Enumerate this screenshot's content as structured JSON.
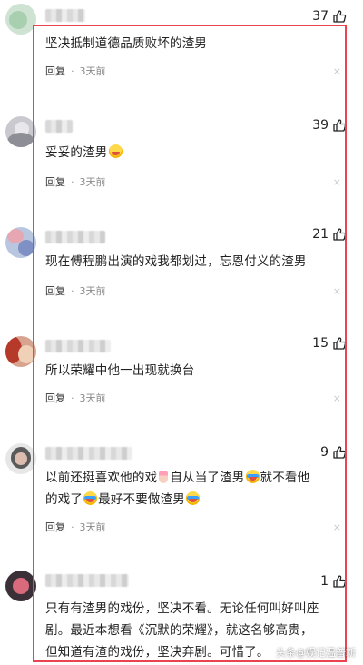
{
  "comments": [
    {
      "likes": "37",
      "text": "坚决抵制道德品质败坏的渣男",
      "reply": "回复",
      "time": "3天前",
      "close": "×"
    },
    {
      "likes": "39",
      "text": "妥妥的渣男",
      "reply": "回复",
      "time": "3天前",
      "close": "×"
    },
    {
      "likes": "21",
      "text": "现在傅程鹏出演的戏我都划过，忘恩付义的渣男",
      "reply": "回复",
      "time": "3天前",
      "close": "×"
    },
    {
      "likes": "15",
      "text": "所以荣耀中他一出现就换台",
      "reply": "回复",
      "time": "3天前",
      "close": "×"
    },
    {
      "likes": "9",
      "text_part1": "以前还挺喜欢他的戏",
      "text_part2": "自从当了渣男",
      "text_part3": "就不看他的戏了",
      "text_part4": "最好不要做渣男",
      "reply": "回复",
      "time": "3天前",
      "close": "×"
    },
    {
      "likes": "1",
      "text": "只有有渣男的戏份，坚决不看。无论任何叫好叫座剧。最近本想看《沉默的荣耀》，就这名够高贵，但知道有渣的戏份，坚决弃剧。可惜了。"
    }
  ],
  "dot": "·",
  "watermark": "头条@娱记温普新",
  "colors": {
    "frame": "#e9444f"
  },
  "icons": {
    "like": "thumbs-up-icon",
    "close": "close-icon",
    "emoji_laugh": "laughing-face-emoji",
    "emoji_laugh_tears": "laughing-tears-emoji",
    "emoji_nail": "nail-polish-emoji"
  }
}
